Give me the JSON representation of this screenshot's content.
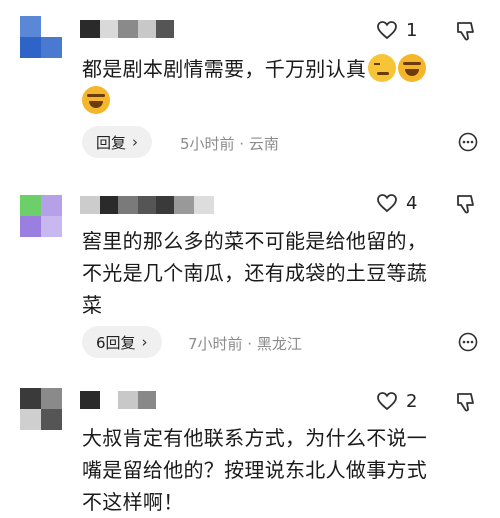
{
  "colors": {
    "background": "#ffffff",
    "pill": "#f0f0f0",
    "meta_text": "#8c8c8c",
    "icon": "#333333"
  },
  "comments": [
    {
      "avatar_colors": [
        "#5a88d6",
        "#ffffff",
        "#2e64c8",
        "#4a7ad0"
      ],
      "name_blocks": [
        "#2a2a2a",
        "#d9d9d9",
        "#8a8a8a",
        "#c8c8c8",
        "#555555"
      ],
      "like_count": "1",
      "text": "都是剧本剧情需要，千万别认真",
      "emojis": [
        "smirking-face",
        "laughing-face",
        "laughing-face"
      ],
      "reply_label": "回复",
      "meta": "5小时前 · 云南"
    },
    {
      "avatar_colors": [
        "#6ccf6a",
        "#b6a0e8",
        "#9a7fe0",
        "#c8b8f0"
      ],
      "name_blocks": [
        "#cccccc",
        "#2a2a2a",
        "#7a7a7a",
        "#555555",
        "#3a3a3a",
        "#999999",
        "#dddddd"
      ],
      "like_count": "4",
      "text_lines": [
        "窖里的那么多的菜不可能是给他留的，",
        "不光是几个南瓜，还有成袋的土豆等蔬",
        "菜"
      ],
      "reply_label": "6回复",
      "meta": "7小时前 · 黑龙江"
    },
    {
      "avatar_colors": [
        "#3a3a3a",
        "#8a8a8a",
        "#cfcfcf",
        "#555555"
      ],
      "name_blocks": [
        "#2a2a2a",
        "#ffffff",
        "#c8c8c8",
        "#888888"
      ],
      "like_count": "2",
      "text_lines": [
        "大叔肯定有他联系方式，为什么不说一",
        "嘴是留给他的？按理说东北人做事方式",
        "不这样啊！"
      ]
    }
  ]
}
